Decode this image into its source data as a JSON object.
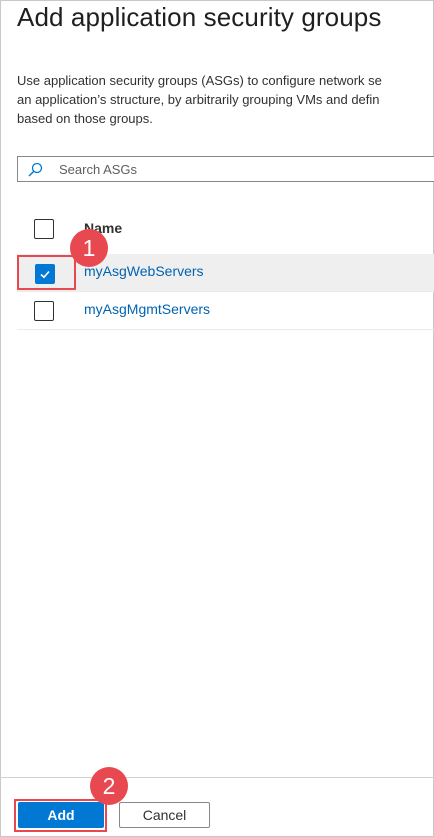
{
  "panel": {
    "title": "Add application security groups",
    "description_lines": [
      "Use application security groups (ASGs) to configure network se",
      "an application’s structure, by arbitrarily grouping VMs and defin",
      "based on those groups."
    ]
  },
  "search": {
    "placeholder": "Search ASGs",
    "icon": "search-icon"
  },
  "table": {
    "header": "Name",
    "rows": [
      {
        "name": "myAsgWebServers",
        "checked": true
      },
      {
        "name": "myAsgMgmtServers",
        "checked": false
      }
    ]
  },
  "annotations": {
    "step1": "1",
    "step2": "2"
  },
  "footer": {
    "add_label": "Add",
    "cancel_label": "Cancel"
  },
  "colors": {
    "accent": "#0078d4",
    "annotation": "#e8484f",
    "link": "#0063b1"
  }
}
